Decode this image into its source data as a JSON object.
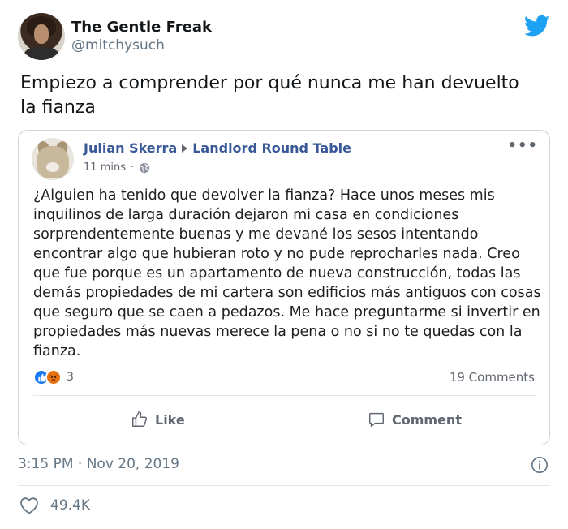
{
  "tweet": {
    "display_name": "The Gentle Freak",
    "handle": "@mitchysuch",
    "text": "Empiezo a comprender por qué nunca me han devuelto la fianza",
    "timestamp": "3:15 PM · Nov 20, 2019",
    "likes": "49.4K",
    "brand_color": "#1da1f2"
  },
  "fb_post": {
    "author": "Julian Skerra",
    "group": "Landlord Round Table",
    "time": "11 mins",
    "body": "¿Alguien ha tenido que devolver la fianza? Hace unos meses mis inquilinos de larga duración dejaron mi casa en condiciones sorprendentemente buenas y me devané los sesos intentando encontrar algo que hubieran roto y no pude reprocharles nada. Creo que fue porque es un apartamento de nueva construcción, todas las demás propiedades de mi cartera son edificios más antiguos con cosas que seguro que se caen a pedazos. Me hace preguntarme si invertir en propiedades más nuevas merece la pena o no si no te quedas con la fianza.",
    "reaction_count": "3",
    "comments_count": "19 Comments",
    "like_label": "Like",
    "comment_label": "Comment",
    "reactions": [
      "like-icon",
      "angry-icon"
    ]
  }
}
